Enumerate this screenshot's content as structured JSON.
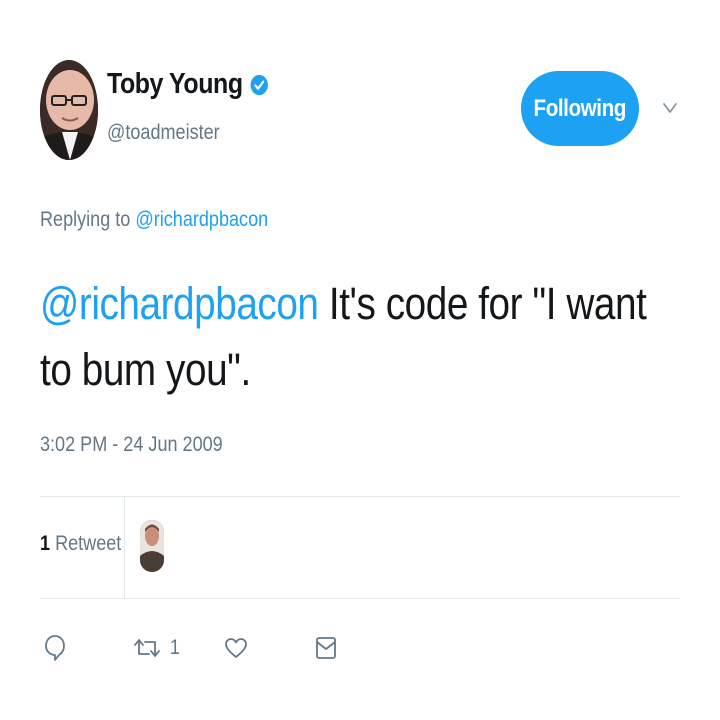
{
  "user": {
    "name": "Toby Young",
    "handle": "@toadmeister"
  },
  "follow_button": {
    "label": "Following"
  },
  "reply_context": {
    "prefix": "Replying to",
    "mention": "@richardpbacon"
  },
  "tweet": {
    "mention": "@richardpbacon",
    "text": "It's code for \"I want to bum you\"."
  },
  "timestamp": "3:02 PM - 24 Jun 2009",
  "stats": {
    "retweet_count": "1",
    "retweet_label": "Retweet"
  },
  "actions": {
    "retweet_count": "1"
  },
  "colors": {
    "accent": "#1da1f2",
    "text": "#14171a",
    "secondary": "#657786",
    "divider": "#e1e8ed"
  }
}
